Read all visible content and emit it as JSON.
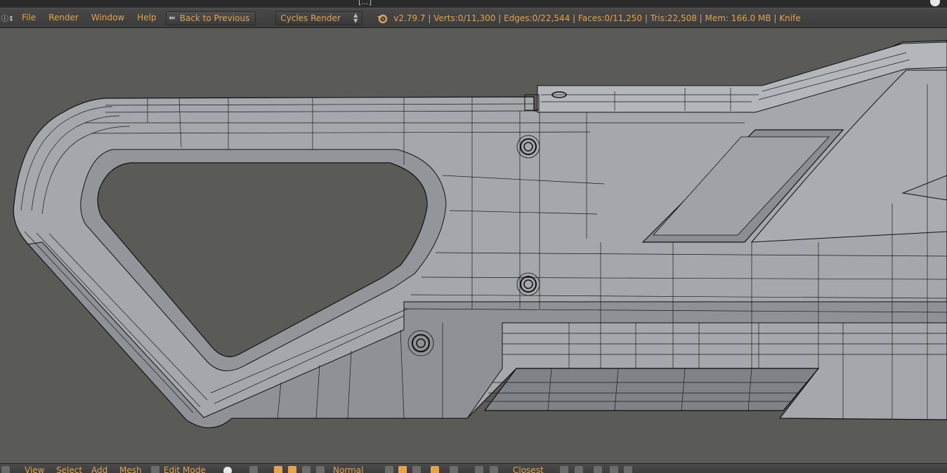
{
  "titlebar": {
    "text": "[...]"
  },
  "info_header": {
    "menus": [
      "File",
      "Render",
      "Window",
      "Help"
    ],
    "back_button": "Back to Previous",
    "render_engine": "Cycles Render",
    "stats": "v2.79.7 | Verts:0/11,300 | Edges:0/22,544 | Faces:0/11,250 | Tris:22,508 | Mem: 166.0 MB | Knife"
  },
  "view3d_header": {
    "menus": [
      "View",
      "Select",
      "Add",
      "Mesh"
    ],
    "mode": "Edit Mode",
    "pivot": "Normal",
    "snap_target": "Closest"
  },
  "icons": {
    "editor_type": "info-icon",
    "back": "back-arrow-icon",
    "logo": "blender-logo-icon",
    "window_close": "close-icon"
  },
  "colors": {
    "accent": "#e2a34a",
    "viewport_bg": "#5a5a56",
    "mesh_face": "#a6a9ad",
    "wire": "#111111"
  }
}
